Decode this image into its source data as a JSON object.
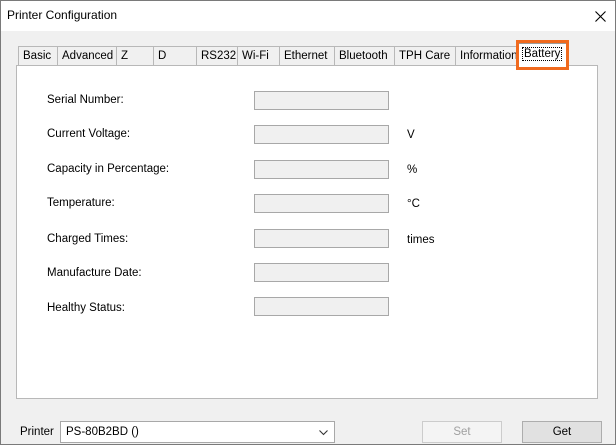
{
  "window": {
    "title": "Printer Configuration",
    "close_icon": "close-icon"
  },
  "tabs": [
    {
      "label": "Basic"
    },
    {
      "label": "Advanced"
    },
    {
      "label": "Z"
    },
    {
      "label": "D"
    },
    {
      "label": "RS232"
    },
    {
      "label": "Wi-Fi"
    },
    {
      "label": "Ethernet"
    },
    {
      "label": "Bluetooth"
    },
    {
      "label": "TPH Care"
    },
    {
      "label": "Information"
    },
    {
      "label": "Battery",
      "active": true
    }
  ],
  "battery": {
    "rows": [
      {
        "label": "Serial Number:",
        "value": "",
        "unit": ""
      },
      {
        "label": "Current Voltage:",
        "value": "",
        "unit": "V"
      },
      {
        "label": "Capacity in Percentage:",
        "value": "",
        "unit": "%"
      },
      {
        "label": "Temperature:",
        "value": "",
        "unit": "°C"
      },
      {
        "label": "Charged Times:",
        "value": "",
        "unit": "times"
      },
      {
        "label": "Manufacture Date:",
        "value": "",
        "unit": ""
      },
      {
        "label": "Healthy Status:",
        "value": "",
        "unit": ""
      }
    ]
  },
  "bottom": {
    "printer_label": "Printer",
    "printer_value": "PS-80B2BD ()",
    "set_label": "Set",
    "get_label": "Get"
  },
  "colors": {
    "highlight": "#f06a1e",
    "field_bg": "#f0f0f0",
    "panel_bg": "#ffffff"
  }
}
